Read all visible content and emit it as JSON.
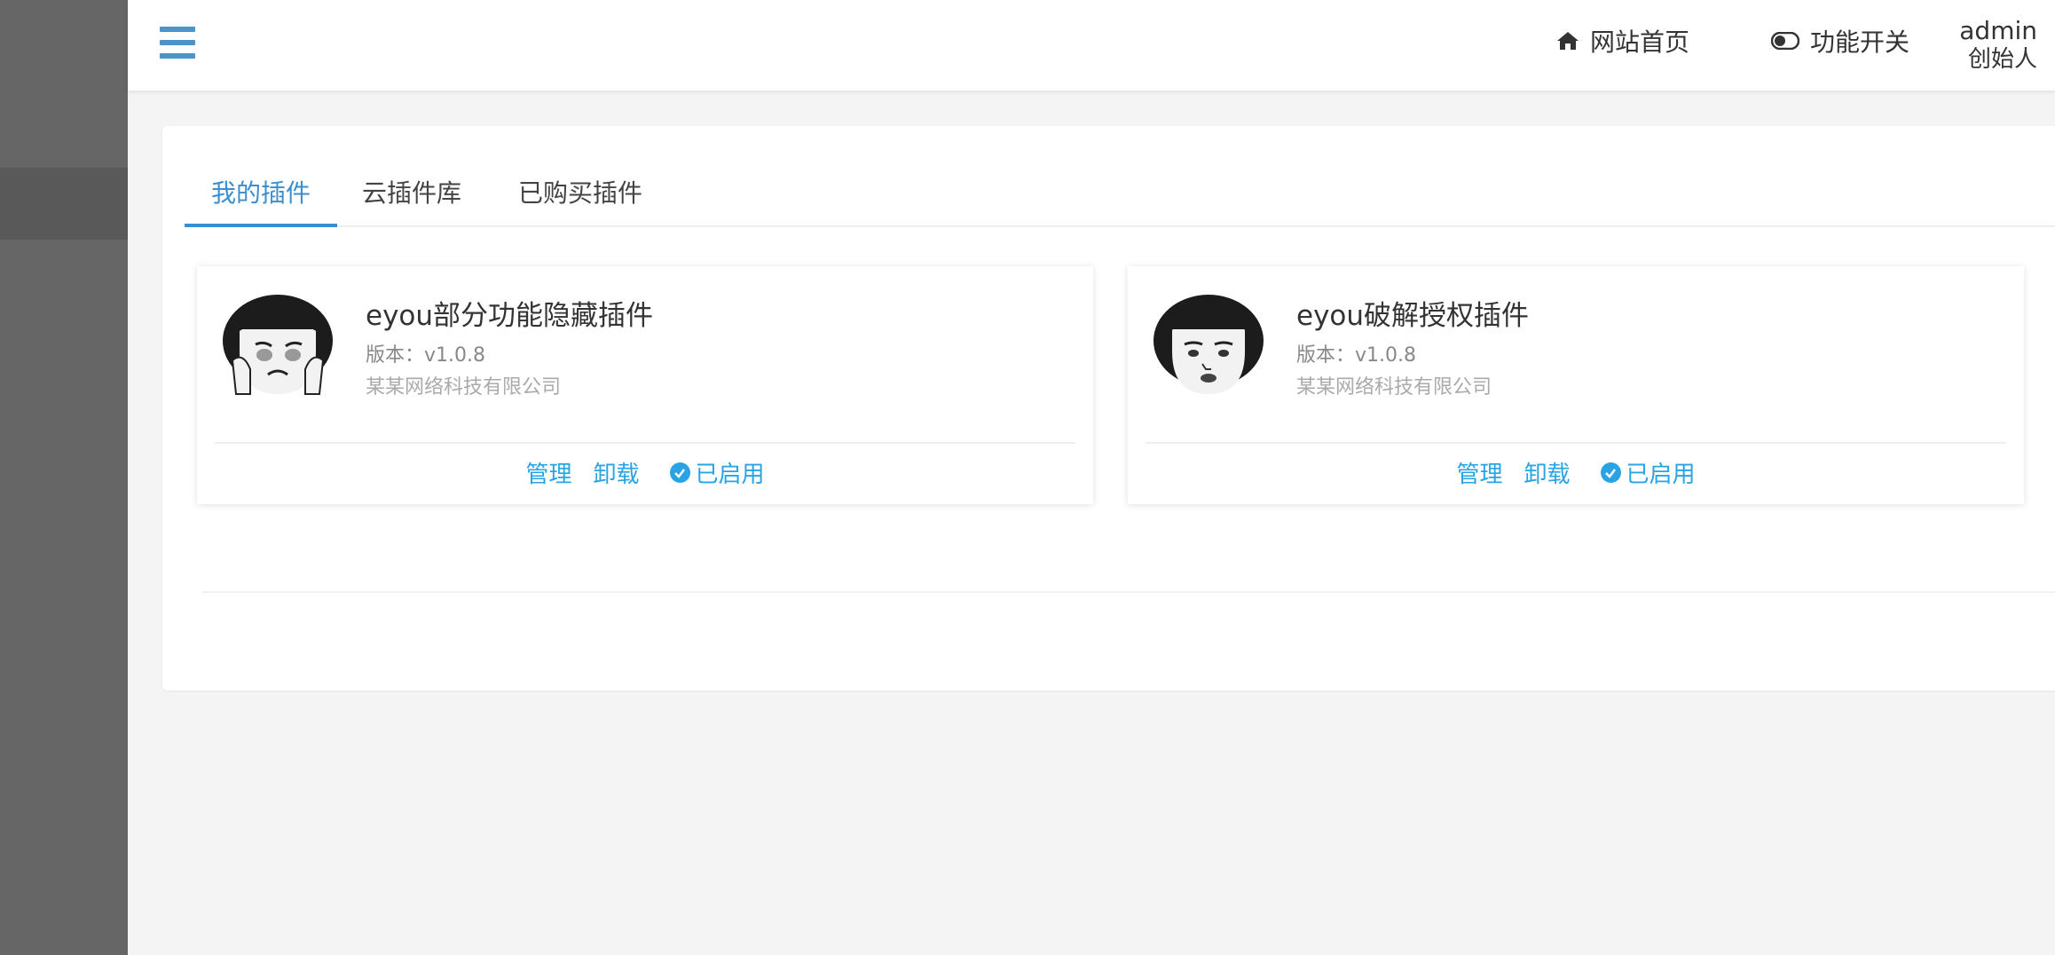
{
  "header": {
    "home_label": "网站首页",
    "switch_label": "功能开关",
    "user_name": "admin",
    "user_role": "创始人"
  },
  "tabs": [
    {
      "label": "我的插件",
      "active": true
    },
    {
      "label": "云插件库",
      "active": false
    },
    {
      "label": "已购买插件",
      "active": false
    }
  ],
  "plugins": [
    {
      "title": "eyou部分功能隐藏插件",
      "version": "版本：v1.0.8",
      "company": "某某网络科技有限公司",
      "manage_label": "管理",
      "uninstall_label": "卸载",
      "status_label": "已启用"
    },
    {
      "title": "eyou破解授权插件",
      "version": "版本：v1.0.8",
      "company": "某某网络科技有限公司",
      "manage_label": "管理",
      "uninstall_label": "卸载",
      "status_label": "已启用"
    }
  ],
  "colors": {
    "accent": "#3b8ed0",
    "link": "#29a3e4",
    "sidebar": "#666666"
  },
  "icons": [
    "menu-icon",
    "home-icon",
    "toggle-icon",
    "check-circle-icon"
  ]
}
